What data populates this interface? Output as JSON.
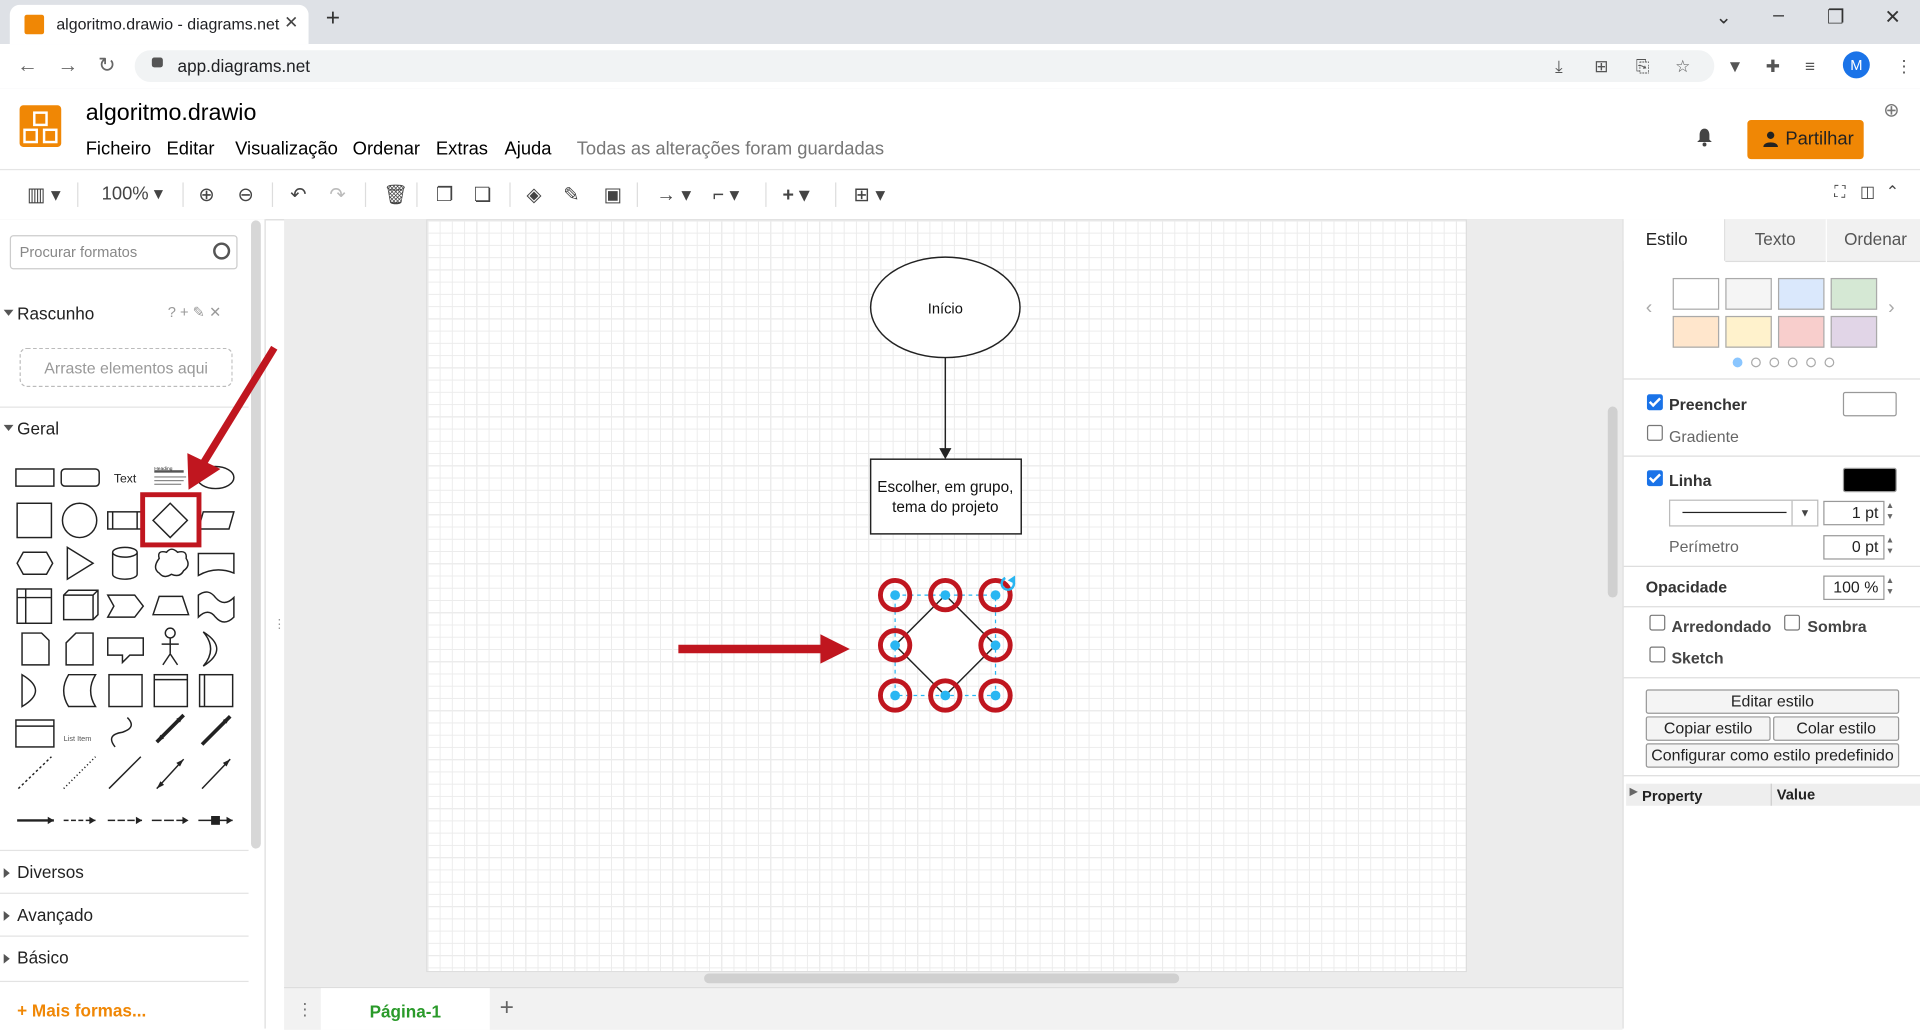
{
  "browser": {
    "tab_title": "algoritmo.drawio - diagrams.net",
    "tab_close": "✕",
    "new_tab": "+",
    "url": "app.diagrams.net",
    "profile_initial": "M",
    "window_controls": [
      "⌄",
      "–",
      "❐",
      "✕"
    ]
  },
  "app": {
    "title": "algoritmo.drawio",
    "menu": [
      "Ficheiro",
      "Editar",
      "Visualização",
      "Ordenar",
      "Extras",
      "Ajuda"
    ],
    "saved_status": "Todas as alterações foram guardadas",
    "share_label": "Partilhar",
    "accent_color": "#f08705"
  },
  "toolbar": {
    "zoom": "100%"
  },
  "left": {
    "search_placeholder": "Procurar formatos",
    "scratchpad": {
      "label": "Rascunho",
      "tools": "? + ✎ ✕",
      "dropzone": "Arraste elementos aqui"
    },
    "general_label": "Geral",
    "shape_text_label": "Text",
    "shape_heading_label": "Heading",
    "shape_listitem_label": "List Item",
    "sections": [
      "Diversos",
      "Avançado",
      "Básico"
    ],
    "more_shapes": "Mais formas..."
  },
  "diagram": {
    "start_label": "Início",
    "process_label_1": "Escolher, em grupo,",
    "process_label_2": "tema do projeto",
    "annotation_color": "#c0161f",
    "handle_color": "#29b6f2"
  },
  "pages": {
    "current": "Página-1",
    "add": "+"
  },
  "right": {
    "tabs": [
      "Estilo",
      "Texto",
      "Ordenar"
    ],
    "fill_label": "Preencher",
    "gradient_label": "Gradiente",
    "line_label": "Linha",
    "line_width": "1 pt",
    "perimeter_label": "Perímetro",
    "perimeter_value": "0 pt",
    "opacity_label": "Opacidade",
    "opacity_value": "100 %",
    "rounded_label": "Arredondado",
    "shadow_label": "Sombra",
    "sketch_label": "Sketch",
    "edit_style": "Editar estilo",
    "copy_style": "Copiar estilo",
    "paste_style": "Colar estilo",
    "set_default": "Configurar como estilo predefinido",
    "prop_header": "Property",
    "value_header": "Value",
    "swatches": [
      "#ffffff",
      "#f5f5f5",
      "#dae8fc",
      "#d5e8d4",
      "#ffe6cc",
      "#fff2cc",
      "#f8cecc",
      "#e1d5e7"
    ]
  }
}
